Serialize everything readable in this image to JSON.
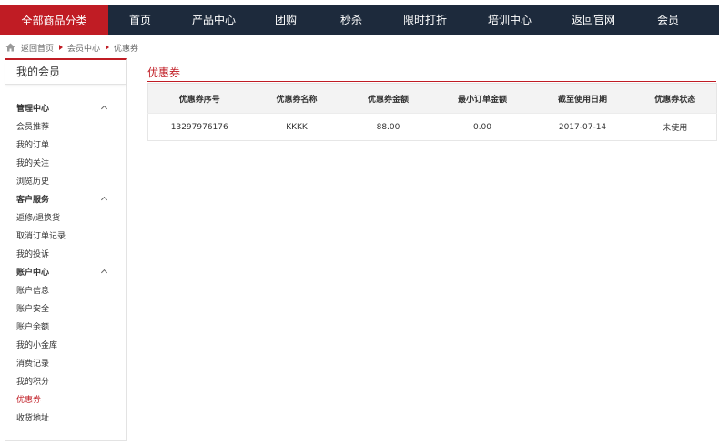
{
  "nav": {
    "all_categories": "全部商品分类",
    "items": [
      "首页",
      "产品中心",
      "团购",
      "秒杀",
      "限时打折",
      "培训中心",
      "返回官网",
      "会员"
    ]
  },
  "breadcrumb": {
    "items": [
      "返回首页",
      "会员中心",
      "优惠券"
    ]
  },
  "sidebar": {
    "title": "我的会员",
    "rows": [
      {
        "label": "管理中心",
        "group": true
      },
      {
        "label": "会员推荐"
      },
      {
        "label": "我的订单"
      },
      {
        "label": "我的关注"
      },
      {
        "label": "浏览历史"
      },
      {
        "label": "客户服务",
        "group": true
      },
      {
        "label": "返修/退换货"
      },
      {
        "label": "取消订单记录"
      },
      {
        "label": "我的投诉"
      },
      {
        "label": "账户中心",
        "group": true
      },
      {
        "label": "账户信息"
      },
      {
        "label": "账户安全"
      },
      {
        "label": "账户余额"
      },
      {
        "label": "我的小金库"
      },
      {
        "label": "消费记录"
      },
      {
        "label": "我的积分"
      },
      {
        "label": "优惠券",
        "active": true
      },
      {
        "label": "收货地址"
      }
    ]
  },
  "main": {
    "title": "优惠券",
    "columns": [
      "优惠券序号",
      "优惠券名称",
      "优惠券金额",
      "最小订单金额",
      "截至使用日期",
      "优惠券状态"
    ],
    "rows": [
      [
        "13297976176",
        "KKKK",
        "88.00",
        "0.00",
        "2017-07-14",
        "未使用"
      ]
    ]
  },
  "colors": {
    "accent": "#c01c24",
    "nav_bg": "#1d2a3c"
  }
}
